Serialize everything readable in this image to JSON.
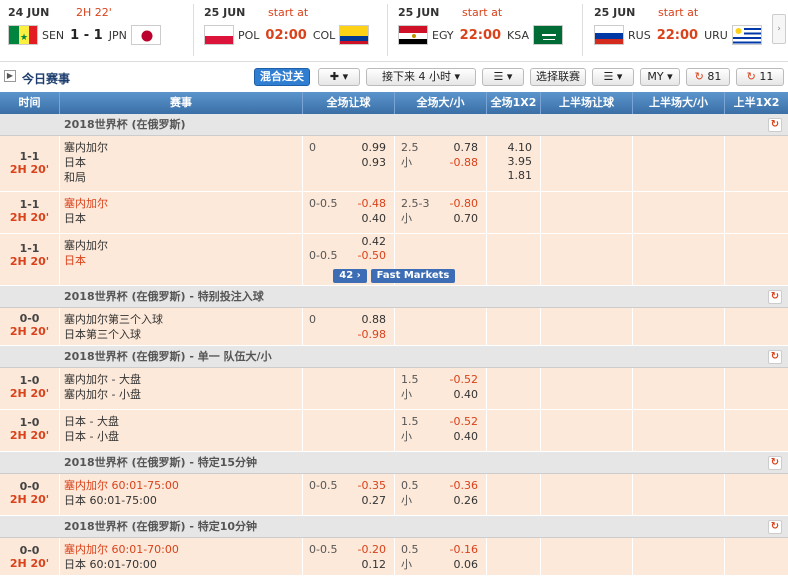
{
  "top_matches": [
    {
      "date": "24 JUN",
      "status": "2H 22'",
      "home": "SEN",
      "score": "1 - 1",
      "away": "JPN"
    },
    {
      "date": "25 JUN",
      "status": "start at",
      "home": "POL",
      "time": "02:00",
      "away": "COL"
    },
    {
      "date": "25 JUN",
      "status": "start at",
      "home": "EGY",
      "time": "22:00",
      "away": "KSA"
    },
    {
      "date": "25 JUN",
      "status": "start at",
      "home": "RUS",
      "time": "22:00",
      "away": "URU"
    }
  ],
  "toolbar": {
    "title": "今日赛事",
    "mix": "混合过关",
    "add": "✚ ▾",
    "period": "接下来 4 小时 ▾",
    "sort": "▾",
    "leagues": "选择联赛",
    "view": "▾",
    "my": "MY ▾",
    "refresh": "81",
    "refresh2": "11"
  },
  "headers": {
    "time": "时间",
    "event": "赛事",
    "ft_hcp": "全场让球",
    "ft_ou": "全场大/小",
    "ft_1x2": "全场1X2",
    "h1_hcp": "上半场让球",
    "h1_ou": "上半场大/小",
    "h1_1x2": "上半1X2"
  },
  "leagues": [
    {
      "name": "2018世界杯 (在俄罗斯)"
    },
    {
      "name": "2018世界杯 (在俄罗斯) - 特别投注入球"
    },
    {
      "name": "2018世界杯 (在俄罗斯) - 单一 队伍大/小"
    },
    {
      "name": "2018世界杯 (在俄罗斯) - 特定15分钟"
    },
    {
      "name": "2018世界杯 (在俄罗斯) - 特定10分钟"
    }
  ],
  "rows": [
    {
      "score": "1-1",
      "live": "2H 20'",
      "teams": [
        "塞内加尔",
        "日本",
        "和局"
      ],
      "hcp_line": "0",
      "hcp": [
        "0.99",
        "0.93"
      ],
      "ou_line": "2.5",
      "ou_u": "小",
      "ou": [
        "0.78",
        "-0.88"
      ],
      "x12": [
        "4.10",
        "3.95",
        "1.81"
      ]
    },
    {
      "score": "1-1",
      "live": "2H 20'",
      "teams": [
        "塞内加尔",
        "日本"
      ],
      "hcp_line": "0-0.5",
      "hcp": [
        "-0.48",
        "0.40"
      ],
      "ou_line": "2.5-3",
      "ou_u": "小",
      "ou": [
        "-0.80",
        "0.70"
      ]
    },
    {
      "score": "1-1",
      "live": "2H 20'",
      "teams": [
        "塞内加尔",
        "日本"
      ],
      "hcp_line": "0-0.5",
      "hcp": [
        "0.42",
        "-0.50"
      ],
      "fast_count": "42 ›",
      "fast_label": "Fast Markets"
    },
    {
      "score": "0-0",
      "live": "2H 20'",
      "teams": [
        "塞内加尔第三个入球",
        "日本第三个入球"
      ],
      "hcp_line": "0",
      "hcp": [
        "0.88",
        "-0.98"
      ]
    },
    {
      "score": "1-0",
      "live": "2H 20'",
      "teams": [
        "塞内加尔 - 大盘",
        "塞内加尔 - 小盘"
      ],
      "ou_line": "1.5",
      "ou_u": "小",
      "ou": [
        "-0.52",
        "0.40"
      ]
    },
    {
      "score": "1-0",
      "live": "2H 20'",
      "teams": [
        "日本 - 大盘",
        "日本 - 小盘"
      ],
      "ou_line": "1.5",
      "ou_u": "小",
      "ou": [
        "-0.52",
        "0.40"
      ]
    },
    {
      "score": "0-0",
      "live": "2H 20'",
      "teams": [
        "塞内加尔 60:01-75:00",
        "日本 60:01-75:00"
      ],
      "hcp_line": "0-0.5",
      "hcp": [
        "-0.35",
        "0.27"
      ],
      "ou_line": "0.5",
      "ou_u": "小",
      "ou": [
        "-0.36",
        "0.26"
      ]
    },
    {
      "score": "0-0",
      "live": "2H 20'",
      "teams": [
        "塞内加尔 60:01-70:00",
        "日本 60:01-70:00"
      ],
      "hcp_line": "0-0.5",
      "hcp": [
        "-0.20",
        "0.12"
      ],
      "ou_line": "0.5",
      "ou_u": "小",
      "ou": [
        "-0.16",
        "0.06"
      ]
    }
  ],
  "colors": {
    "accent": "#d9421b",
    "header": "#3a6fa6",
    "row": "#fde9d9",
    "league": "#e6e6e6"
  }
}
